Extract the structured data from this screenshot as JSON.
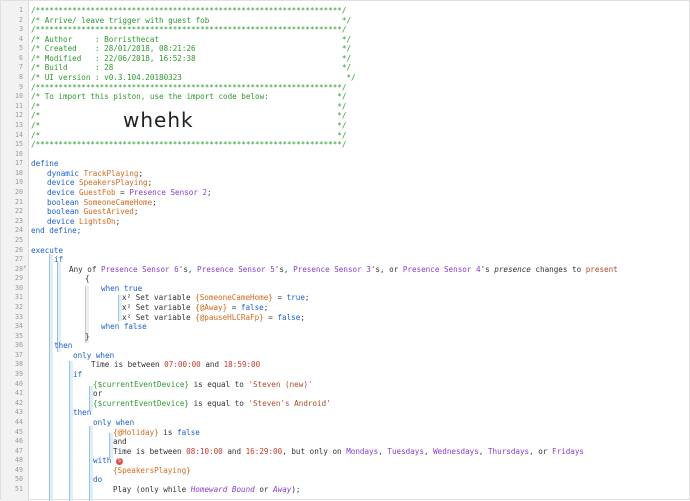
{
  "header": {
    "sep": "/*******************************************************************/",
    "title": "/* Arrive/ leave trigger with guest fob                             */",
    "author": "/* Author     : Borristhecat                                        */",
    "created": "/* Created    : 28/01/2018, 08:21:26                                */",
    "modified": "/* Modified   : 22/06/2018, 16:52:38                                */",
    "build": "/* Build      : 28                                                  */",
    "ui": "/* UI version : v0.3.104.20180323                                    */",
    "import_line": "/* To import this piston, use the import code below:               */",
    "blank": "/*                                                                 */",
    "import_code": "whehk"
  },
  "define": {
    "kw": "define",
    "l17": [
      "dynamic",
      "TrackPlaying",
      ";"
    ],
    "l18": [
      "device",
      "SpeakersPlaying",
      ";"
    ],
    "l19": [
      "device",
      "GuestFob",
      " = ",
      "Presence Sensor 2",
      ";"
    ],
    "l20": [
      "boolean",
      "SomeoneCameHome",
      ";"
    ],
    "l21": [
      "boolean",
      "GuestArived",
      ";"
    ],
    "l22": [
      "device",
      "LightsOn",
      ";"
    ],
    "end": "end define;"
  },
  "execute": {
    "kw": "execute",
    "if": "if",
    "cond": {
      "pre": "Any of ",
      "s6": "Presence Sensor 6",
      "m1": "'s, ",
      "s5": "Presence Sensor 5",
      "m2": "'s, ",
      "s3": "Presence Sensor 3",
      "m3": "'s, or ",
      "s4": "Presence Sensor 4",
      "m4": "'s ",
      "attr": "presence",
      "m5": " changes to ",
      "val": "present"
    },
    "brace_open": "{",
    "when_true": "when true",
    "set1": [
      "x² Set variable ",
      "{SomeoneCameHome}",
      " = ",
      "true",
      ";"
    ],
    "set2": [
      "x² Set variable ",
      "{@Away}",
      " = ",
      "false",
      ";"
    ],
    "set3": [
      "x² Set variable ",
      "{@pauseHLCRaFp}",
      " = ",
      "false",
      ";"
    ],
    "when_false": "when false",
    "brace_close": "}",
    "then": "then",
    "only_when": "only when",
    "time1": [
      "Time",
      " is between ",
      "07:00:00",
      " and ",
      "18:59:00"
    ],
    "if2": "if",
    "l40": [
      "{$currentEventDevice}",
      " is equal to ",
      "'Steven (new)'"
    ],
    "or": "or",
    "l42": [
      "{$currentEventDevice}",
      " is equal to ",
      "'Steven's Android'"
    ],
    "then2": "then",
    "only_when2": "only when",
    "l45": [
      "{@Holiday}",
      " is ",
      "false"
    ],
    "and": "and",
    "l47": [
      "Time",
      " is between ",
      "08:10:00",
      " and ",
      "16:29:00",
      ", but only on ",
      "Mondays",
      ", ",
      "Tuesdays",
      ", ",
      "Wednesdays",
      ", ",
      "Thursdays",
      ", or ",
      "Fridays"
    ],
    "with": "with",
    "badge": "S",
    "l49": "{SpeakersPlaying}",
    "do": "do",
    "l51": [
      "Play (only while ",
      "Homeward Bound",
      " or ",
      "Away",
      ");"
    ]
  },
  "line_numbers": [
    "1",
    "2",
    "3",
    "4",
    "5",
    "6",
    "7",
    "8",
    "9",
    "10",
    "11",
    "12",
    "13",
    "14",
    "15",
    "16",
    "17",
    "18",
    "19",
    "20",
    "21",
    "22",
    "23",
    "24",
    "25",
    "26",
    "27",
    "28",
    "29",
    "30",
    "31",
    "32",
    "33",
    "34",
    "35",
    "36",
    "37",
    "38",
    "39",
    "40",
    "41",
    "42",
    "43",
    "44",
    "45",
    "46",
    "47",
    "48",
    "49",
    "50",
    "51"
  ]
}
